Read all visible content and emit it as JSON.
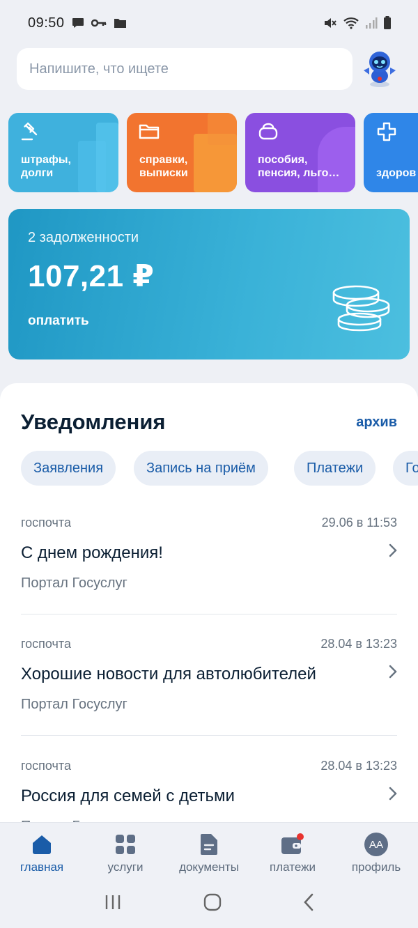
{
  "status_bar": {
    "time": "09:50"
  },
  "search": {
    "placeholder": "Напишите, что ищете"
  },
  "tiles": [
    {
      "label": "штрафы,\nдолги",
      "icon": "gavel-icon",
      "color": "#3fb1dd"
    },
    {
      "label": "справки,\nвыписки",
      "icon": "folder-icon",
      "color": "#f2742f"
    },
    {
      "label": "пособия,\nпенсия, льго…",
      "icon": "purse-icon",
      "color": "#8a4fe0"
    },
    {
      "label": "здоров",
      "icon": "plus-icon",
      "color": "#2f86e8"
    }
  ],
  "debt": {
    "count_text": "2 задолженности",
    "amount": "107,21 ₽",
    "pay_label": "оплатить"
  },
  "notifications": {
    "title": "Уведомления",
    "archive_label": "архив",
    "chips": [
      "Заявления",
      "Запись на приём",
      "Платежи",
      "Го"
    ],
    "items": [
      {
        "source": "госпочта",
        "date": "29.06 в 11:53",
        "title": "С днем рождения!",
        "sender": "Портал Госуслуг"
      },
      {
        "source": "госпочта",
        "date": "28.04 в 13:23",
        "title": "Хорошие новости для автолюбителей",
        "sender": "Портал Госуслуг"
      },
      {
        "source": "госпочта",
        "date": "28.04 в 13:23",
        "title": "Россия для семей с детьми",
        "sender": "Портал Госуслуг"
      }
    ]
  },
  "bottom_nav": [
    {
      "label": "главная",
      "icon": "home-icon",
      "active": true
    },
    {
      "label": "услуги",
      "icon": "grid-icon",
      "active": false
    },
    {
      "label": "документы",
      "icon": "document-icon",
      "active": false
    },
    {
      "label": "платежи",
      "icon": "wallet-icon",
      "active": false,
      "badge": true
    },
    {
      "label": "профиль",
      "icon": "avatar",
      "initials": "АА",
      "active": false
    }
  ],
  "colors": {
    "accent": "#1a5ca8",
    "debt_card": "#2ea6d0",
    "badge": "#e8332f"
  }
}
